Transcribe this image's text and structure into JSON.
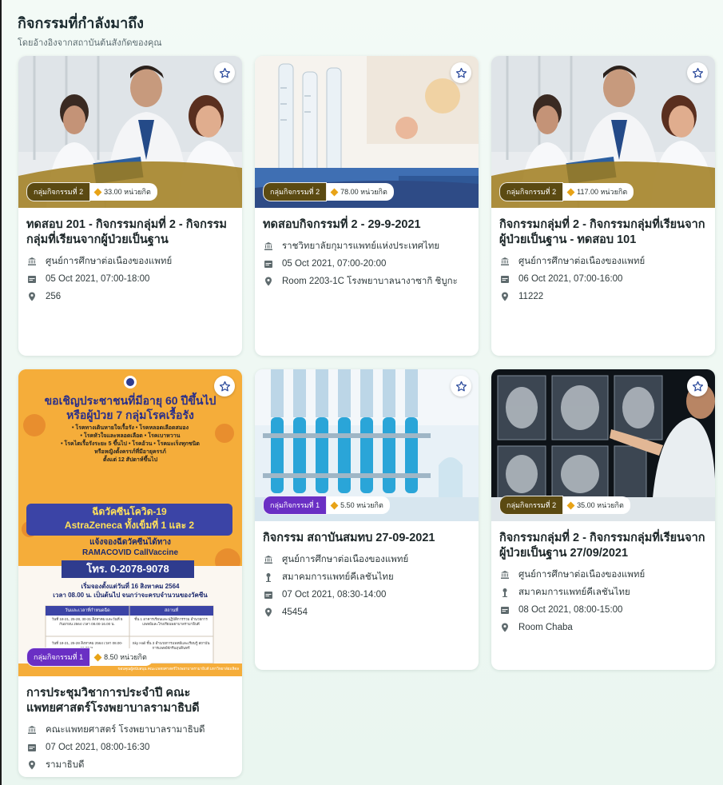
{
  "header": {
    "title": "กิจกรรมที่กำลังมาถึง",
    "subtitle": "โดยอ้างอิงจากสถาบันต้นสังกัดของคุณ"
  },
  "colors": {
    "group1_badge": "#6a2fc4",
    "group2_badge": "#5b4a12",
    "diamond": "#e8a317",
    "star": "#2b4a9b"
  },
  "cards": [
    {
      "group": "กลุ่มกิจกรรมที่ 2",
      "credits": "33.00 หน่วยกิต",
      "title": "ทดสอบ 201 - กิจกรรมกลุ่มที่ 2 - กิจกรรมกลุ่มที่เรียนจากผู้ป่วยเป็นฐาน",
      "organizer": "ศูนย์การศึกษาต่อเนื่องของแพทย์",
      "datetime": "05 Oct 2021, 07:00-18:00",
      "location": "256"
    },
    {
      "group": "กลุ่มกิจกรรมที่ 2",
      "credits": "78.00 หน่วยกิต",
      "title": "ทดสอบกิจกรรมที่ 2 - 29-9-2021",
      "organizer": "ราชวิทยาลัยกุมารแพทย์แห่งประเทศไทย",
      "datetime": "05 Oct 2021, 07:00-20:00",
      "location": "Room 2203-1C โรงพยาบาลนางาซากิ ชิบูกะ"
    },
    {
      "group": "กลุ่มกิจกรรมที่ 2",
      "credits": "117.00 หน่วยกิต",
      "title": "กิจกรรมกลุ่มที่ 2 - กิจกรรมกลุ่มที่เรียนจากผู้ป่วยเป็นฐาน - ทดสอบ 101",
      "organizer": "ศูนย์การศึกษาต่อเนื่องของแพทย์",
      "datetime": "06 Oct 2021, 07:00-16:00",
      "location": "11222"
    },
    {
      "group": "กลุ่มกิจกรรมที่ 1",
      "credits": "8.50 หน่วยกิต",
      "title": "การประชุมวิชาการประจำปี คณะแพทยศาสตร์โรงพยาบาลรามาธิบดี",
      "organizer": "คณะแพทยศาสตร์ โรงพยาบาลรามาธิบดี",
      "datetime": "07 Oct 2021, 08:00-16:30",
      "location": "รามาธิบดี"
    },
    {
      "group": "กลุ่มกิจกรรมที่ 1",
      "credits": "5.50 หน่วยกิต",
      "title": "กิจกรรม สถาบันสมทบ 27-09-2021",
      "organizer": "ศูนย์การศึกษาต่อเนื่องของแพทย์",
      "partner": "สมาคมการแพทย์คีเลชั่นไทย",
      "datetime": "07 Oct 2021, 08:30-14:00",
      "location": "45454"
    },
    {
      "group": "กลุ่มกิจกรรมที่ 2",
      "credits": "35.00 หน่วยกิต",
      "title": "กิจกรรมกลุ่มที่ 2 - กิจกรรมกลุ่มที่เรียนจากผู้ป่วยเป็นฐาน 27/09/2021",
      "organizer": "ศูนย์การศึกษาต่อเนื่องของแพทย์",
      "partner": "สมาคมการแพทย์คีเลชั่นไทย",
      "datetime": "08 Oct 2021, 08:00-15:00",
      "location": "Room Chaba"
    }
  ],
  "poster": {
    "headline_1": "ขอเชิญประชาชนที่มีอายุ 60 ปีขึ้นไป",
    "headline_2": "หรือผู้ป่วย 7 กลุ่มโรคเรื้อรัง",
    "diseases_1": "• โรคทางเดินหายใจเรื้อรัง • โรคหลอดเลือดสมอง",
    "diseases_2": "• โรคหัวใจและหลอดเลือด • โรคเบาหวาน",
    "diseases_3": "• โรคไตเรื้อรังระยะ 5 ขึ้นไป • โรคอ้วน • โรคมะเร็งทุกชนิด",
    "pregnant_1": "หรือหญิงตั้งครรภ์ที่มีอายุครรภ์",
    "pregnant_2": "ตั้งแต่ 12 สัปดาห์ขึ้นไป",
    "vaccine_1": "ฉีดวัคซีนโควิด-19",
    "vaccine_2": "AstraZeneca ทั้งเข็มที่ 1 และ 2",
    "register_1": "แจ้งจองฉีดวัคซีนได้ทาง",
    "register_2": "RAMACOVID CallVaccine",
    "phone": "โทร. 0-2078-9078",
    "start_1": "เริ่มจองตั้งแต่วันที่ 16 สิงหาคม 2564",
    "start_2": "เวลา 08.00 น. เป็นต้นไป จนกว่าจะครบจำนวนของวัคซีน",
    "table_head_1": "วันและเวลาที่กำหนดฉีด",
    "table_head_2": "สถานที่",
    "row1_col1": "วันที่ 18-21, 25-28, 30-31 สิงหาคม และวันที่ 5 กันยายน 2564 เวลา 08.00-16.00 น.",
    "row1_col2": "ชั้น 1 อาคารเรียนและปฏิบัติการรวม อำนวยการแพทย์และโรงเรียนพยาบาลรามาธิบดี",
    "row2_col1": "วันที่ 18-21, 25-28 สิงหาคม 2564 เวลา 08.00-16.00 น.",
    "row2_col2": "Sky Hall ชั้น 3 อำนวยการแพทย์และเรียนรู้ สถาบันการแพทย์จักรีนฤบดินทร์",
    "footer": "ขอบคุณผู้สนับสนุน คณะแพทยศาสตร์โรงพยาบาลรามาธิบดี มหาวิทยาลัยมหิดล"
  }
}
